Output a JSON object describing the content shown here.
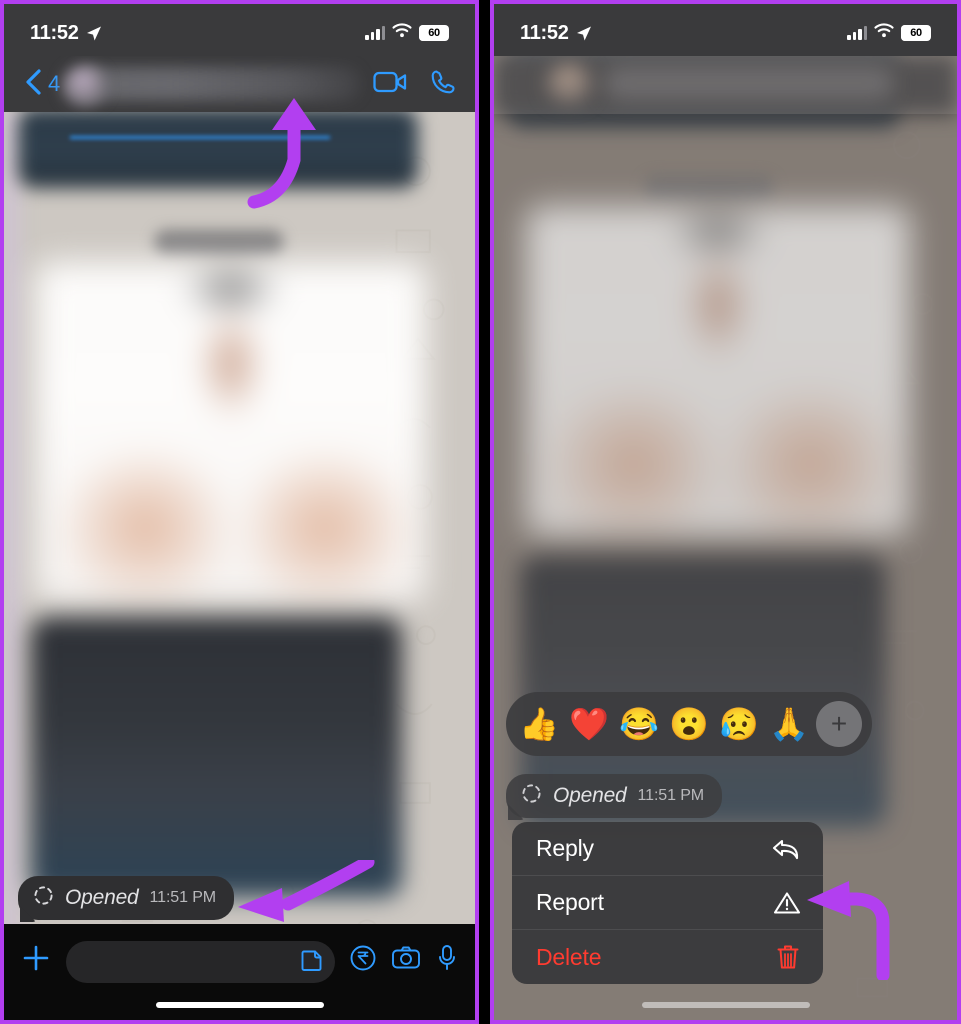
{
  "meta": {
    "app": "WhatsApp iOS chat",
    "accent_blue": "#2f9bff",
    "arrow_purple": "#b23ff0",
    "danger_red": "#ff3b30"
  },
  "status_bar": {
    "time": "11:52",
    "battery_percent": "60",
    "location_icon": "location-arrow-icon",
    "cellular_icon": "cellular-bars-icon",
    "wifi_icon": "wifi-icon",
    "battery_icon": "battery-icon"
  },
  "left_panel": {
    "nav": {
      "back_icon": "chevron-left-icon",
      "unread_count": "4",
      "video_call_icon": "video-camera-icon",
      "voice_call_icon": "phone-icon"
    },
    "receipt": {
      "status_icon": "dashed-circle-icon",
      "label": "Opened",
      "time": "11:51 PM"
    },
    "toolbar": {
      "attach_icon": "plus-icon",
      "input_placeholder": "",
      "input_value": "",
      "sticker_icon": "sticker-icon",
      "payment_icon": "rupee-icon",
      "camera_icon": "camera-icon",
      "mic_icon": "microphone-icon"
    },
    "annotation": {
      "arrow_top": "curved-arrow-up",
      "arrow_bottom": "curved-arrow-left"
    }
  },
  "right_panel": {
    "reactions": {
      "emojis": [
        {
          "name": "thumbs-up-reaction",
          "glyph": "👍"
        },
        {
          "name": "red-heart-reaction",
          "glyph": "❤️"
        },
        {
          "name": "face-with-tears-of-joy-reaction",
          "glyph": "😂"
        },
        {
          "name": "face-with-open-mouth-reaction",
          "glyph": "😮"
        },
        {
          "name": "sad-but-relieved-face-reaction",
          "glyph": "😥"
        },
        {
          "name": "folded-hands-reaction",
          "glyph": "🙏"
        }
      ],
      "more_label": "+"
    },
    "receipt": {
      "status_icon": "dashed-circle-icon",
      "label": "Opened",
      "time": "11:51 PM"
    },
    "context_menu": {
      "items": [
        {
          "label": "Reply",
          "icon": "reply-arrow-icon",
          "danger": false
        },
        {
          "label": "Report",
          "icon": "warning-triangle-icon",
          "danger": false
        },
        {
          "label": "Delete",
          "icon": "trash-icon",
          "danger": true
        }
      ]
    },
    "annotation": {
      "arrow_to_report": "curved-arrow-left"
    }
  }
}
